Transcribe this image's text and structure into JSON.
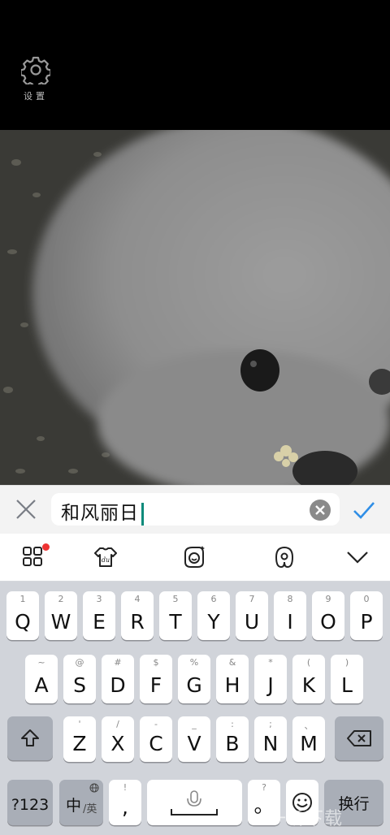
{
  "settings": {
    "label": "设置",
    "icon": "gear-icon"
  },
  "input": {
    "value": "和风丽日"
  },
  "toolbar": {
    "icons": [
      "grid-icon",
      "skin-icon",
      "emoji-icon",
      "handwriting-icon",
      "collapse-icon"
    ],
    "badge_color": "#ee3333"
  },
  "keyboard": {
    "row1": [
      {
        "sub": "1",
        "main": "Q"
      },
      {
        "sub": "2",
        "main": "W"
      },
      {
        "sub": "3",
        "main": "E"
      },
      {
        "sub": "4",
        "main": "R"
      },
      {
        "sub": "5",
        "main": "T"
      },
      {
        "sub": "6",
        "main": "Y"
      },
      {
        "sub": "7",
        "main": "U"
      },
      {
        "sub": "8",
        "main": "I"
      },
      {
        "sub": "9",
        "main": "O"
      },
      {
        "sub": "0",
        "main": "P"
      }
    ],
    "row2": [
      {
        "sub": "~",
        "main": "A"
      },
      {
        "sub": "@",
        "main": "S"
      },
      {
        "sub": "#",
        "main": "D"
      },
      {
        "sub": "$",
        "main": "F"
      },
      {
        "sub": "%",
        "main": "G"
      },
      {
        "sub": "&",
        "main": "H"
      },
      {
        "sub": "*",
        "main": "J"
      },
      {
        "sub": "(",
        "main": "K"
      },
      {
        "sub": ")",
        "main": "L"
      }
    ],
    "row3": [
      {
        "sub": "'",
        "main": "Z"
      },
      {
        "sub": "/",
        "main": "X"
      },
      {
        "sub": "-",
        "main": "C"
      },
      {
        "sub": "_",
        "main": "V"
      },
      {
        "sub": ":",
        "main": "B"
      },
      {
        "sub": ";",
        "main": "N"
      },
      {
        "sub": "、",
        "main": "M"
      }
    ],
    "num_label": "?123",
    "lang_label": "中",
    "lang_sub": "/英",
    "comma_sub": "!",
    "comma_main": ",",
    "period_sub": "?",
    "period_main": "。",
    "enter_label": "换行"
  },
  "watermark": "一听下载"
}
